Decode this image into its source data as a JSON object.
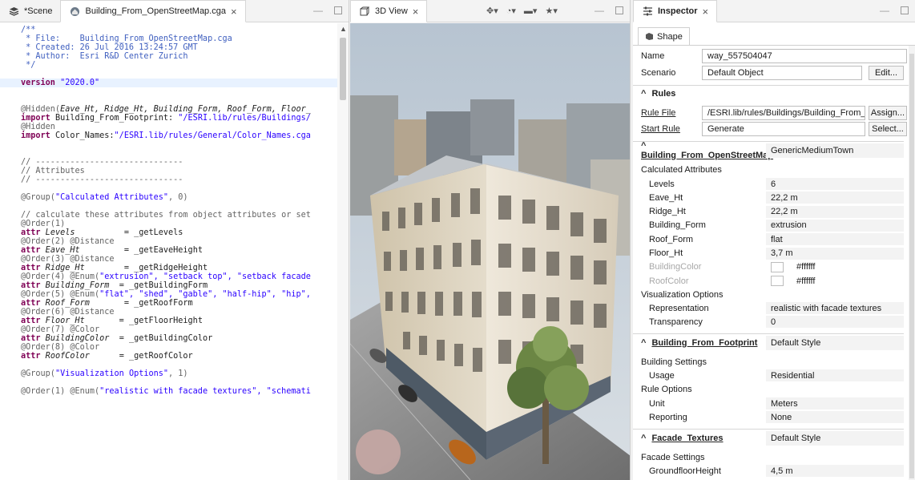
{
  "editor": {
    "tabs": [
      {
        "label": "*Scene"
      },
      {
        "label": "Building_From_OpenStreetMap.cga"
      }
    ],
    "code_lines": [
      [
        [
          "c-cm",
          "/**"
        ]
      ],
      [
        [
          "c-cm",
          " * File:    Building_From_OpenStreetMap.cga"
        ]
      ],
      [
        [
          "c-cm",
          " * Created: 26 Jul 2016 13:24:57 GMT"
        ]
      ],
      [
        [
          "c-cm",
          " * Author:  Esri R&D Center Zurich"
        ]
      ],
      [
        [
          "c-cm",
          " */"
        ]
      ],
      [],
      [
        [
          "c-kw",
          "version"
        ],
        [
          "c-st",
          " \"2020.0\""
        ]
      ],
      [],
      [],
      [
        [
          "c-an",
          "@Hidden("
        ],
        [
          "c-it",
          "Eave_Ht, Ridge_Ht, Building_Form, Roof_Form, Floor_"
        ]
      ],
      [
        [
          "c-kw",
          "import"
        ],
        [
          "c-pl",
          " Building_From_Footprint: "
        ],
        [
          "c-st",
          "\"/ESRI.lib/rules/Buildings/"
        ]
      ],
      [
        [
          "c-an",
          "@Hidden"
        ]
      ],
      [
        [
          "c-kw",
          "import"
        ],
        [
          "c-pl",
          " Color_Names:"
        ],
        [
          "c-st",
          "\"/ESRI.lib/rules/General/Color_Names.cga"
        ]
      ],
      [],
      [],
      [
        [
          "c-an",
          "// ------------------------------"
        ]
      ],
      [
        [
          "c-an",
          "// Attributes"
        ]
      ],
      [
        [
          "c-an",
          "// ------------------------------"
        ]
      ],
      [],
      [
        [
          "c-an",
          "@Group("
        ],
        [
          "c-st",
          "\"Calculated Attributes\""
        ],
        [
          "c-an",
          ", 0)"
        ]
      ],
      [],
      [
        [
          "c-an",
          "// calculate these attributes from object attributes or set"
        ]
      ],
      [
        [
          "c-an",
          "@Order(1)"
        ]
      ],
      [
        [
          "c-kw",
          "attr"
        ],
        [
          "c-it",
          " Levels"
        ],
        [
          "c-pl",
          "          = _getLevels"
        ]
      ],
      [
        [
          "c-an",
          "@Order(2) @Distance"
        ]
      ],
      [
        [
          "c-kw",
          "attr"
        ],
        [
          "c-it",
          " Eave_Ht"
        ],
        [
          "c-pl",
          "         = _getEaveHeight"
        ]
      ],
      [
        [
          "c-an",
          "@Order(3) @Distance"
        ]
      ],
      [
        [
          "c-kw",
          "attr"
        ],
        [
          "c-it",
          " Ridge_Ht"
        ],
        [
          "c-pl",
          "        = _getRidgeHeight"
        ]
      ],
      [
        [
          "c-an",
          "@Order(4) @Enum("
        ],
        [
          "c-st",
          "\"extrusion\", \"setback top\", \"setback facade"
        ]
      ],
      [
        [
          "c-kw",
          "attr"
        ],
        [
          "c-it",
          " Building_Form"
        ],
        [
          "c-pl",
          "  = _getBuildingForm"
        ]
      ],
      [
        [
          "c-an",
          "@Order(5) @Enum("
        ],
        [
          "c-st",
          "\"flat\", \"shed\", \"gable\", \"half-hip\", \"hip\","
        ]
      ],
      [
        [
          "c-kw",
          "attr"
        ],
        [
          "c-it",
          " Roof_Form"
        ],
        [
          "c-pl",
          "       = _getRoofForm"
        ]
      ],
      [
        [
          "c-an",
          "@Order(6) @Distance"
        ]
      ],
      [
        [
          "c-kw",
          "attr"
        ],
        [
          "c-it",
          " Floor_Ht"
        ],
        [
          "c-pl",
          "       = _getFloorHeight"
        ]
      ],
      [
        [
          "c-an",
          "@Order(7) @Color"
        ]
      ],
      [
        [
          "c-kw",
          "attr"
        ],
        [
          "c-it",
          " BuildingColor"
        ],
        [
          "c-pl",
          "  = _getBuildingColor"
        ]
      ],
      [
        [
          "c-an",
          "@Order(8) @Color"
        ]
      ],
      [
        [
          "c-kw",
          "attr"
        ],
        [
          "c-it",
          " RoofColor"
        ],
        [
          "c-pl",
          "      = _getRoofColor"
        ]
      ],
      [],
      [
        [
          "c-an",
          "@Group("
        ],
        [
          "c-st",
          "\"Visualization Options\""
        ],
        [
          "c-an",
          ", 1)"
        ]
      ],
      [],
      [
        [
          "c-an",
          "@Order(1) @Enum("
        ],
        [
          "c-st",
          "\"realistic with facade textures\", \"schemati"
        ]
      ]
    ],
    "highlight_line": 6
  },
  "view3d": {
    "tab_label": "3D View",
    "colors": {
      "sky": "#c9d3de",
      "street": "#8f8f8f",
      "facade": "#d8cdb8",
      "tree": "#5f7d3a"
    }
  },
  "inspector": {
    "tab_label": "Inspector",
    "subtab_label": "Shape",
    "name_label": "Name",
    "name_value": "way_557504047",
    "scenario_label": "Scenario",
    "scenario_value": "Default Object",
    "edit_button": "Edit...",
    "rules_header": "Rules",
    "rule_file_label": "Rule File",
    "rule_file_value": "/ESRI.lib/rules/Buildings/Building_From_Oper",
    "assign_button": "Assign...",
    "start_rule_label": "Start Rule",
    "start_rule_value": "Generate",
    "select_button": "Select...",
    "osm_section": {
      "title": "Building_From_OpenStreetMap",
      "value": "GenericMediumTown"
    },
    "calc_group": "Calculated Attributes",
    "calc_attrs": [
      {
        "k": "Levels",
        "v": "6"
      },
      {
        "k": "Eave_Ht",
        "v": "22,2 m"
      },
      {
        "k": "Ridge_Ht",
        "v": "22,2 m"
      },
      {
        "k": "Building_Form",
        "v": "extrusion"
      },
      {
        "k": "Roof_Form",
        "v": "flat"
      },
      {
        "k": "Floor_Ht",
        "v": "3,7 m"
      },
      {
        "k": "BuildingColor",
        "v": "#ffffff"
      },
      {
        "k": "RoofColor",
        "v": "#ffffff"
      }
    ],
    "vis_group": "Visualization Options",
    "vis_attrs": [
      {
        "k": "Representation",
        "v": "realistic with facade textures"
      },
      {
        "k": "Transparency",
        "v": "0"
      }
    ],
    "footprint_section": {
      "title": "Building_From_Footprint",
      "value": "Default Style"
    },
    "bsettings_group": "Building Settings",
    "usage": {
      "k": "Usage",
      "v": "Residential"
    },
    "ruleopts_group": "Rule Options",
    "unit": {
      "k": "Unit",
      "v": "Meters"
    },
    "reporting": {
      "k": "Reporting",
      "v": "None"
    },
    "facade_section": {
      "title": "Facade_Textures",
      "value": "Default Style"
    },
    "facade_group": "Facade Settings",
    "ground": {
      "k": "GroundfloorHeight",
      "v": "4,5 m"
    }
  }
}
